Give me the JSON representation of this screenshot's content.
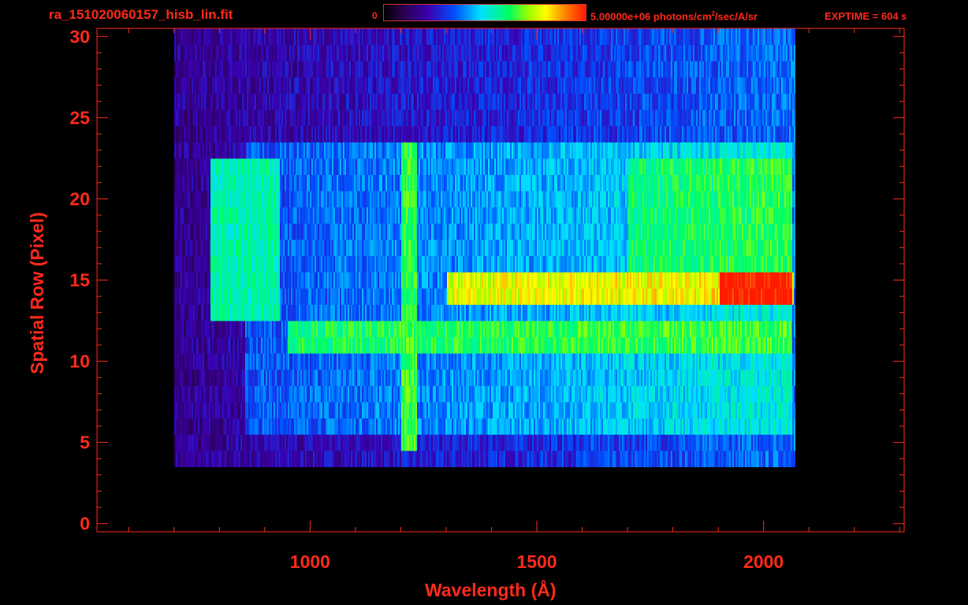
{
  "header": {
    "file_title": "ra_151020060157_hisb_lin.fit",
    "colorbar_min": "0",
    "colorbar_max_value": "5.00000e+06 photons/cm",
    "colorbar_max_exp": "2",
    "colorbar_max_unit": "/sec/A/sr",
    "exptime": "EXPTIME = 604 s"
  },
  "colors": {
    "text": "#ff2a1a",
    "axes": "#ff2a1a",
    "background": "#000000"
  },
  "chart_data": {
    "type": "heatmap",
    "title": "",
    "xlabel": "Wavelength (Å)",
    "ylabel": "Spatial Row (Pixel)",
    "xlim": [
      530,
      2310
    ],
    "ylim": [
      -0.5,
      30.5
    ],
    "x_ticks": [
      1000,
      1500,
      2000
    ],
    "x_tick_labels": [
      "1000",
      "1500",
      "2000"
    ],
    "y_ticks": [
      0,
      5,
      10,
      15,
      20,
      25,
      30
    ],
    "y_tick_labels": [
      "0",
      "5",
      "10",
      "15",
      "20",
      "25",
      "30"
    ],
    "colorbar": {
      "min": 0,
      "max": 5000000,
      "unit": "photons/cm2/sec/A/sr",
      "colormap": "rainbow"
    },
    "features": [
      {
        "name": "",
        "x_range": [
          700,
          2070
        ],
        "rows": [
          4,
          30
        ],
        "level": 0.18
      },
      {
        "name": "",
        "x_range": [
          855,
          2060
        ],
        "rows": [
          6,
          23
        ],
        "level": 0.32
      },
      {
        "name": "",
        "x_range": [
          1200,
          1235
        ],
        "rows": [
          5,
          23
        ],
        "level": 0.62
      },
      {
        "name": "",
        "x_range": [
          950,
          2060
        ],
        "rows": [
          11,
          12
        ],
        "level": 0.6
      },
      {
        "name": "",
        "x_range": [
          1300,
          2065
        ],
        "rows": [
          14,
          15
        ],
        "level": 0.75
      },
      {
        "name": "",
        "x_range": [
          1900,
          2060
        ],
        "rows": [
          14,
          15
        ],
        "level": 0.95
      },
      {
        "name": "",
        "x_range": [
          780,
          930
        ],
        "rows": [
          13,
          22
        ],
        "level": 0.55
      },
      {
        "name": "",
        "x_range": [
          1700,
          2060
        ],
        "rows": [
          16,
          22
        ],
        "level": 0.45
      }
    ]
  }
}
